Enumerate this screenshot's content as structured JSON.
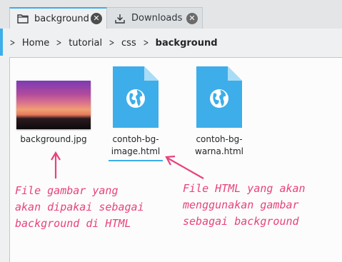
{
  "tabs": [
    {
      "label": "background",
      "icon": "folder-icon",
      "active": true
    },
    {
      "label": "Downloads",
      "icon": "download-icon",
      "active": false
    }
  ],
  "breadcrumb": [
    "Home",
    "tutorial",
    "css",
    "background"
  ],
  "files": [
    {
      "name": "background.jpg",
      "type": "image"
    },
    {
      "name": "contoh-bg-\nimage.html",
      "type": "html"
    },
    {
      "name": "contoh-bg-\nwarna.html",
      "type": "html"
    }
  ],
  "annotations": {
    "left": "File gambar yang\nakan dipakai sebagai\nbackground di HTML",
    "right": "File HTML yang akan\nmenggunakan gambar\nsebagai background"
  },
  "colors": {
    "accent": "#3daee9",
    "annotation": "#e8427c",
    "html_icon": "#3daee9"
  }
}
